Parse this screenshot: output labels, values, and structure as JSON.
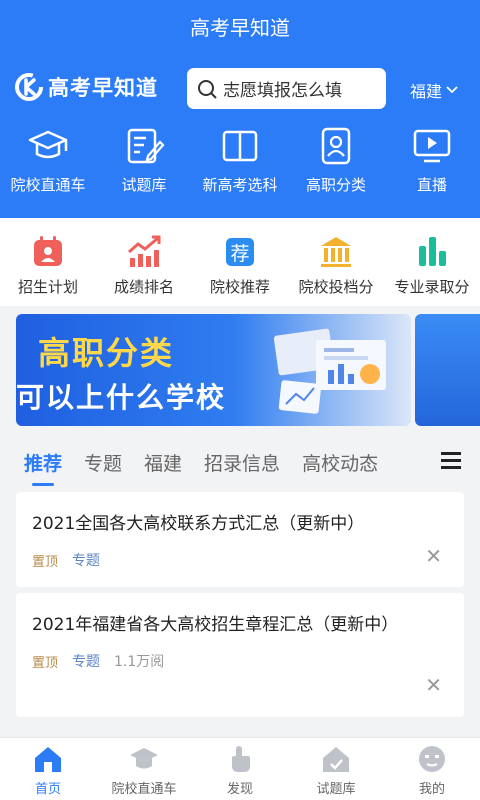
{
  "header": {
    "title": "高考早知道"
  },
  "brand": {
    "name": "高考早知道"
  },
  "search": {
    "placeholder": "志愿填报怎么填"
  },
  "region": {
    "label": "福建"
  },
  "quick_nav": [
    {
      "label": "院校直通车",
      "icon": "graduation-cap-icon"
    },
    {
      "label": "试题库",
      "icon": "exam-paper-icon"
    },
    {
      "label": "新高考选科",
      "icon": "book-icon"
    },
    {
      "label": "高职分类",
      "icon": "id-card-icon"
    },
    {
      "label": "直播",
      "icon": "play-screen-icon"
    }
  ],
  "sub_nav": [
    {
      "label": "招生计划",
      "icon": "calendar-icon",
      "color": "#f0605a"
    },
    {
      "label": "成绩排名",
      "icon": "trend-chart-icon",
      "color": "#f2705a"
    },
    {
      "label": "院校推荐",
      "icon": "recommend-badge-icon",
      "color": "#2b8df0"
    },
    {
      "label": "院校投档分",
      "icon": "institution-icon",
      "color": "#f3b12e"
    },
    {
      "label": "专业录取分",
      "icon": "bar-chart-icon",
      "color": "#1bbd9c"
    }
  ],
  "banner": {
    "title": "高职分类",
    "subtitle": "可以上什么学校"
  },
  "tabs": [
    "推荐",
    "专题",
    "福建",
    "招录信息",
    "高校动态"
  ],
  "articles": [
    {
      "title": "2021全国各大高校联系方式汇总（更新中）",
      "pin": "置顶",
      "topic": "专题",
      "reads": ""
    },
    {
      "title": "2021年福建省各大高校招生章程汇总（更新中）",
      "pin": "置顶",
      "topic": "专题",
      "reads": "1.1万阅"
    }
  ],
  "bottom_nav": [
    {
      "label": "首页",
      "icon": "home-icon",
      "active": true
    },
    {
      "label": "院校直通车",
      "icon": "graduation-cap-icon"
    },
    {
      "label": "发现",
      "icon": "tap-hand-icon"
    },
    {
      "label": "试题库",
      "icon": "exam-house-icon"
    },
    {
      "label": "我的",
      "icon": "face-icon"
    }
  ],
  "colors": {
    "primary": "#2b7cf6",
    "banner_title": "#ffd84a",
    "pin_tag": "#b98a4c",
    "topic_tag": "#5b84c4"
  }
}
